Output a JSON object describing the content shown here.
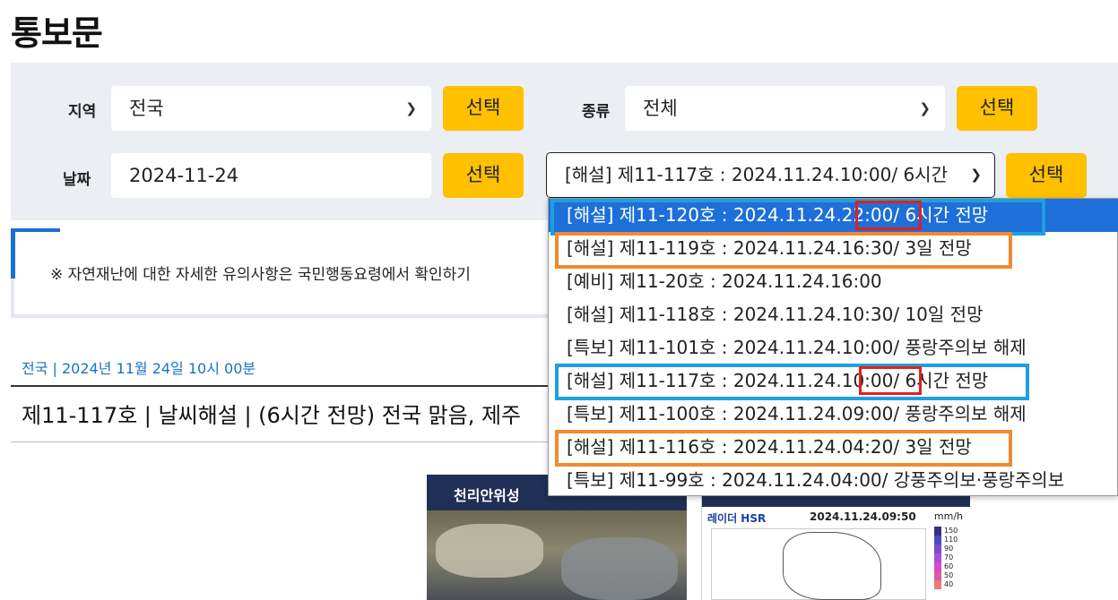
{
  "page": {
    "title": "통보문"
  },
  "filters": {
    "region_label": "지역",
    "region_value": "전국",
    "type_label": "종류",
    "type_value": "전체",
    "date_label": "날짜",
    "date_value": "2024-11-24",
    "select_button": "선택",
    "doc_value": "[해설] 제11-117호 : 2024.11.24.10:00/ 6시간"
  },
  "notice": {
    "text": "※ 자연재난에 대한 자세한 유의사항은 국민행동요령에서 확인하기"
  },
  "article": {
    "meta": "전국 | 2024년 11월 24일 10시 00분",
    "title": "제11-117호 | 날씨해설 | (6시간 전망) 전국 맑음, 제주"
  },
  "images": {
    "satellite_title": "천리안위성",
    "radar_label": "레이더 HSR",
    "radar_time": "2024.11.24.09:50",
    "radar_unit": "mm/h",
    "legend": [
      "150",
      "110",
      "90",
      "70",
      "60",
      "50",
      "40"
    ],
    "legend_colors": [
      "#33337a",
      "#4a4ac8",
      "#7a4ad0",
      "#b04ad8",
      "#d84ac8",
      "#e05aa0",
      "#e87a7a"
    ]
  },
  "dropdown": {
    "items": [
      {
        "label": "[해설] 제11-120호 : 2024.11.24.22:00/ 6시간 전망",
        "selected": true
      },
      {
        "label": "[해설] 제11-119호 : 2024.11.24.16:30/ 3일 전망"
      },
      {
        "label": "[예비] 제11-20호 : 2024.11.24.16:00"
      },
      {
        "label": "[해설] 제11-118호 : 2024.11.24.10:30/ 10일 전망"
      },
      {
        "label": "[특보] 제11-101호 : 2024.11.24.10:00/ 풍랑주의보 해제"
      },
      {
        "label": "[해설] 제11-117호 : 2024.11.24.10:00/ 6시간 전망"
      },
      {
        "label": "[특보] 제11-100호 : 2024.11.24.09:00/ 풍랑주의보 해제"
      },
      {
        "label": "[해설] 제11-116호 : 2024.11.24.04:20/ 3일 전망"
      },
      {
        "label": "[특보] 제11-99호 : 2024.11.24.04:00/ 강풍주의보·풍랑주의보"
      }
    ]
  },
  "colors": {
    "accent_yellow": "#ffc000",
    "highlight_blue": "#1e9fe0",
    "highlight_orange": "#f28a2e",
    "highlight_red": "#e02020",
    "selected_bg": "#1e6fd9"
  }
}
